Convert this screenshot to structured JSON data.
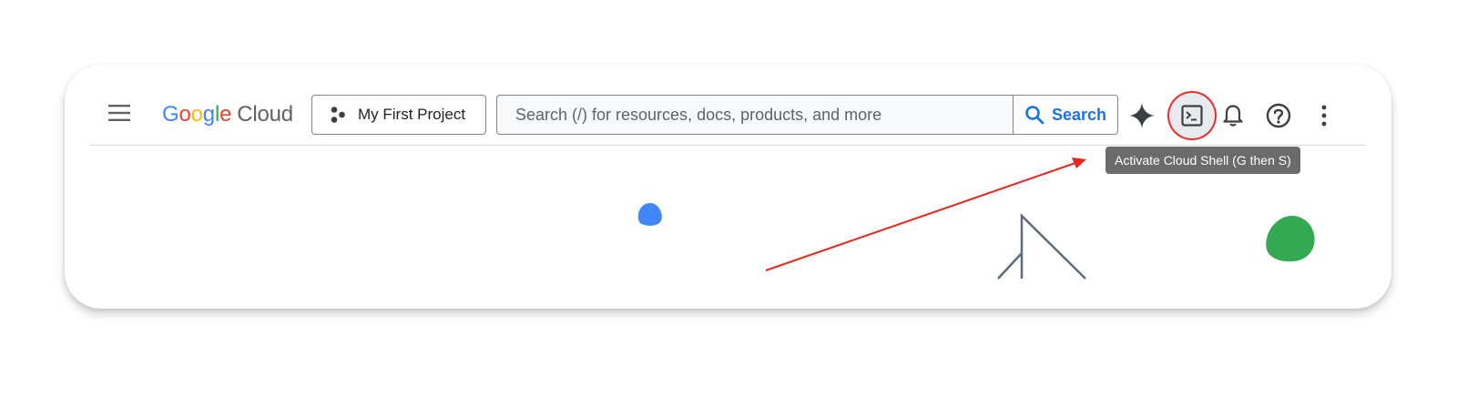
{
  "header": {
    "menu_icon": "hamburger-menu-icon",
    "logo": {
      "letters": [
        "G",
        "o",
        "o",
        "g",
        "l",
        "e"
      ],
      "product": "Cloud"
    },
    "project_picker": {
      "label": "My First Project",
      "icon": "project-nodes-icon"
    },
    "search": {
      "placeholder": "Search (/) for resources, docs, products, and more",
      "value": "",
      "button_label": "Search",
      "icon": "search-icon"
    },
    "actions": [
      {
        "name": "gemini",
        "icon": "sparkle-icon"
      },
      {
        "name": "cloud-shell",
        "icon": "terminal-icon"
      },
      {
        "name": "notifications",
        "icon": "bell-icon"
      },
      {
        "name": "help",
        "icon": "help-circle-icon"
      },
      {
        "name": "more",
        "icon": "more-vertical-icon"
      }
    ]
  },
  "tooltip": {
    "text": "Activate Cloud Shell (G then S)"
  },
  "colors": {
    "google_blue": "#4285F4",
    "google_red": "#EA4335",
    "google_yellow": "#FBBC04",
    "google_green": "#34A853",
    "link_blue": "#1a73e8",
    "highlight_red": "#ea2e2e",
    "icon_gray": "#5f6368"
  }
}
